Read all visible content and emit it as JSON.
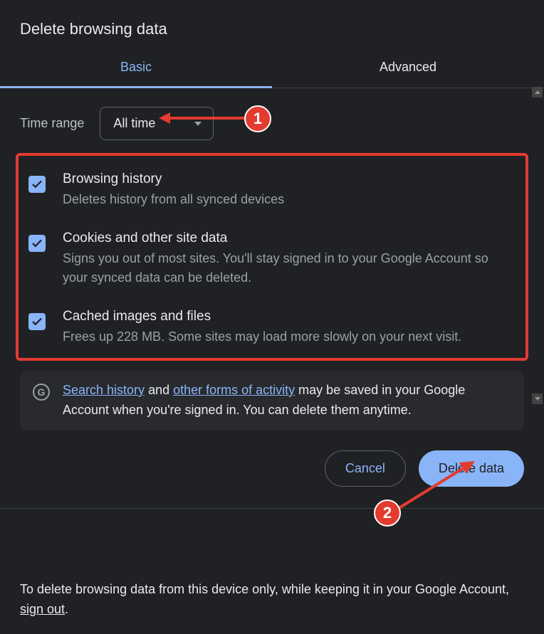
{
  "title": "Delete browsing data",
  "tabs": {
    "basic": "Basic",
    "advanced": "Advanced"
  },
  "timeRange": {
    "label": "Time range",
    "value": "All time"
  },
  "rows": [
    {
      "checked": true,
      "title": "Browsing history",
      "desc": "Deletes history from all synced devices"
    },
    {
      "checked": true,
      "title": "Cookies and other site data",
      "desc": "Signs you out of most sites. You'll stay signed in to your Google Account so your synced data can be deleted."
    },
    {
      "checked": true,
      "title": "Cached images and files",
      "desc": "Frees up 228 MB. Some sites may load more slowly on your next visit."
    }
  ],
  "info": {
    "glogo": "G",
    "link1": "Search history",
    "mid1": " and ",
    "link2": "other forms of activity",
    "rest": " may be saved in your Google Account when you're signed in. You can delete them anytime."
  },
  "buttons": {
    "cancel": "Cancel",
    "delete": "Delete data"
  },
  "footerNote": {
    "pre": "To delete browsing data from this device only, while keeping it in your Google Account, ",
    "link": "sign out",
    "post": "."
  },
  "annotations": {
    "badge1": "1",
    "badge2": "2"
  }
}
